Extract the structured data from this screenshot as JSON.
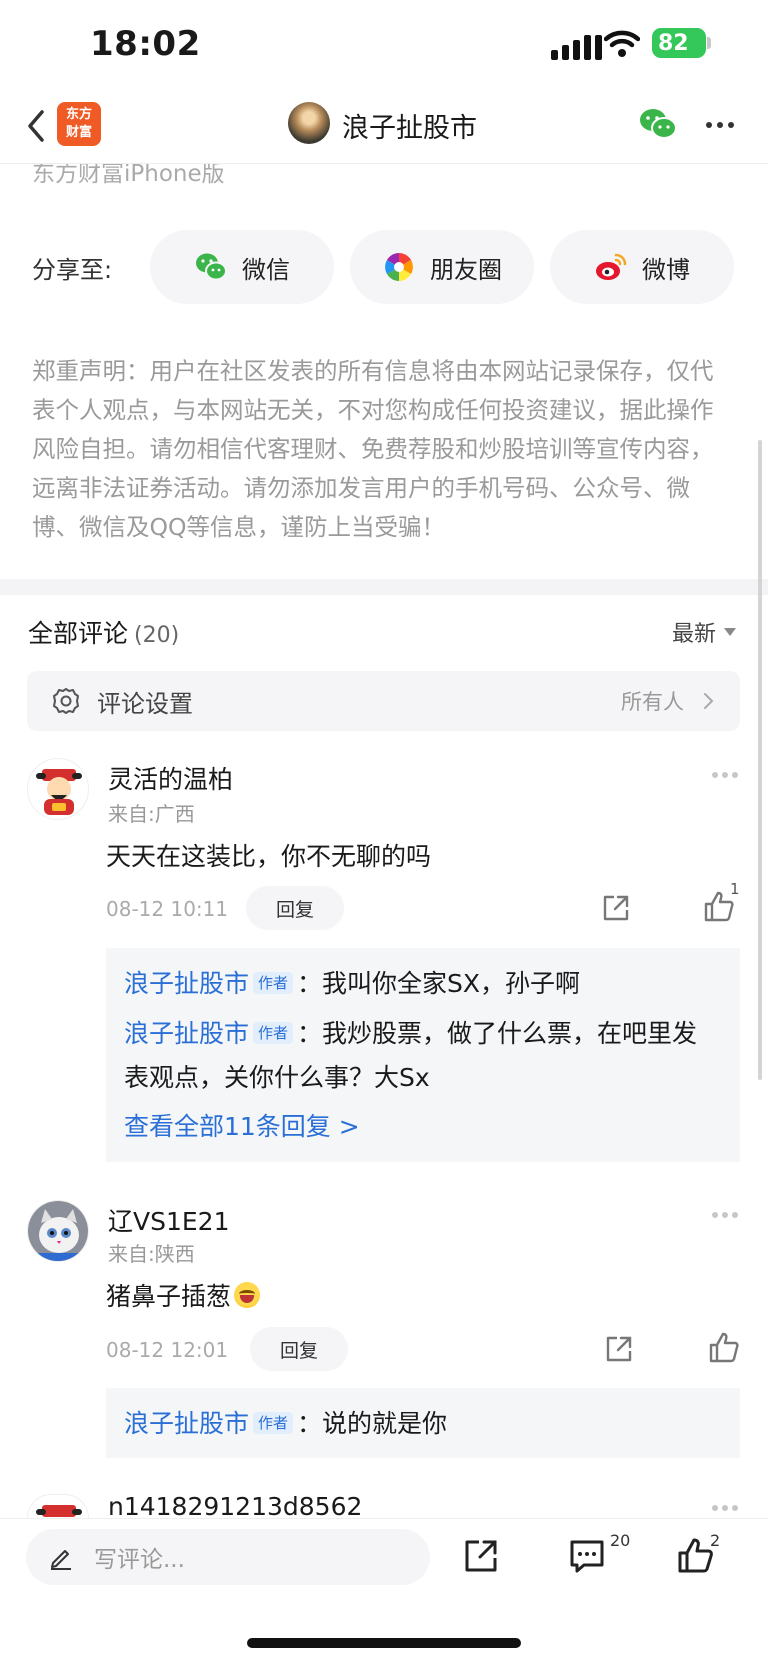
{
  "status": {
    "time": "18:02",
    "battery": "82"
  },
  "nav": {
    "logo_line1": "东方",
    "logo_line2": "财富",
    "title": "浪子扯股市"
  },
  "source_text": "东方财富iPhone版",
  "share": {
    "label": "分享至:",
    "wechat": "微信",
    "moments": "朋友圈",
    "weibo": "微博"
  },
  "disclaimer": "郑重声明：用户在社区发表的所有信息将由本网站记录保存，仅代表个人观点，与本网站无关，不对您构成任何投资建议，据此操作风险自担。请勿相信代客理财、免费荐股和炒股培训等宣传内容，远离非法证券活动。请勿添加发言用户的手机号码、公众号、微博、微信及QQ等信息，谨防上当受骗！",
  "comments_header": {
    "title": "全部评论",
    "count": "(20)",
    "sort": "最新"
  },
  "comment_settings": {
    "label": "评论设置",
    "value": "所有人"
  },
  "comments": [
    {
      "name": "灵活的温柏",
      "location": "来自:广西",
      "text": "天天在这装比，你不无聊的吗",
      "time": "08-12 10:11",
      "reply_label": "回复",
      "likes": "1",
      "replies": [
        {
          "author": "浪子扯股市",
          "tag": "作者",
          "text": "我叫你全家SX，孙子啊"
        },
        {
          "author": "浪子扯股市",
          "tag": "作者",
          "text": "我炒股票，做了什么票，在吧里发表观点，关你什么事？大Sx"
        }
      ],
      "view_all": "查看全部11条回复 >"
    },
    {
      "name": "辽VS1E21",
      "location": "来自:陕西",
      "text": "猪鼻子插葱",
      "time": "08-12 12:01",
      "reply_label": "回复",
      "replies": [
        {
          "author": "浪子扯股市",
          "tag": "作者",
          "text": "说的就是你"
        }
      ]
    },
    {
      "name": "n1418291213d8562"
    }
  ],
  "bottom": {
    "placeholder": "写评论...",
    "comment_count": "20",
    "like_count": "2"
  },
  "colors": {
    "link_blue": "#2a6fd6",
    "battery_green": "#34c759",
    "logo_orange": "#f05a24"
  }
}
